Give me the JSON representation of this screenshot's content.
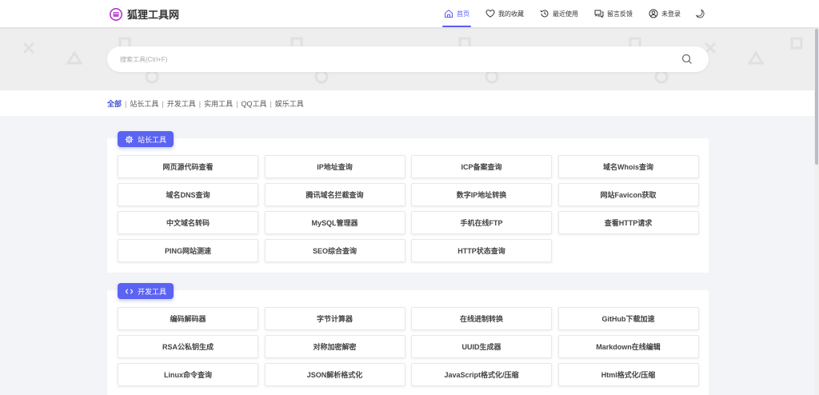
{
  "header": {
    "logo_text": "狐狸工具网",
    "nav": [
      {
        "label": "首页",
        "icon": "home-icon",
        "active": true
      },
      {
        "label": "我的收藏",
        "icon": "heart-icon",
        "active": false
      },
      {
        "label": "最近使用",
        "icon": "history-icon",
        "active": false
      },
      {
        "label": "留言反馈",
        "icon": "chat-icon",
        "active": false
      },
      {
        "label": "未登录",
        "icon": "user-icon",
        "active": false
      }
    ],
    "theme_icon": "moon-icon"
  },
  "search": {
    "placeholder": "搜索工具(Ctrl+F)",
    "button_icon": "search-icon"
  },
  "categories": {
    "items": [
      "全部",
      "站长工具",
      "开发工具",
      "实用工具",
      "QQ工具",
      "娱乐工具"
    ],
    "active_index": 0
  },
  "sections": [
    {
      "title": "站长工具",
      "icon": "gear-icon",
      "tools": [
        "网页源代码查看",
        "IP地址查询",
        "ICP备案查询",
        "域名Whois查询",
        "域名DNS查询",
        "腾讯域名拦截查询",
        "数字IP地址转换",
        "网站Favicon获取",
        "中文域名转码",
        "MySQL管理器",
        "手机在线FTP",
        "查看HTTP请求",
        "PING网站测速",
        "SEO综合查询",
        "HTTP状态查询"
      ]
    },
    {
      "title": "开发工具",
      "icon": "code-icon",
      "tools": [
        "编码解码器",
        "字节计算器",
        "在线进制转换",
        "GitHub下载加速",
        "RSA公私钥生成",
        "对称加密解密",
        "UUID生成器",
        "Markdown在线编辑",
        "Linux命令查询",
        "JSON解析格式化",
        "JavaScript格式化/压缩",
        "Html格式化/压缩"
      ]
    }
  ],
  "colors": {
    "accent": "#5b63f3",
    "active_nav": "#5b5ff0",
    "active_cat": "#3f51d8"
  }
}
